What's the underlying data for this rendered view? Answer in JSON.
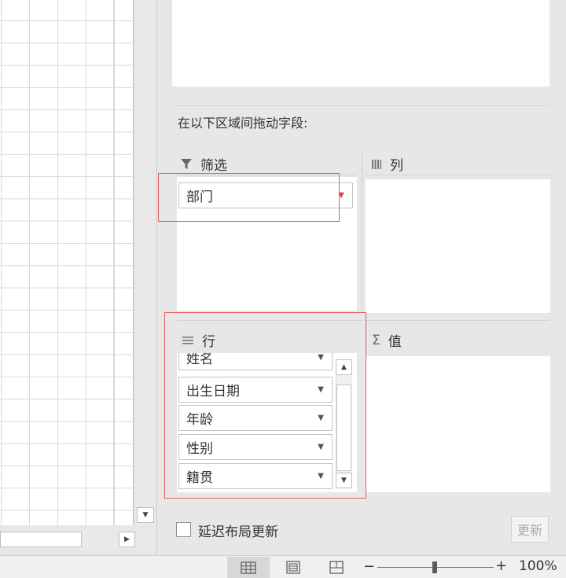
{
  "pane": {
    "drag_hint": "在以下区域间拖动字段:",
    "filters": {
      "title": "筛选",
      "icon": "filter-icon",
      "fields": [
        "部门"
      ]
    },
    "columns": {
      "title": "列",
      "icon": "columns-icon",
      "fields": []
    },
    "rows": {
      "title": "行",
      "icon": "rows-icon",
      "fields": [
        "姓名",
        "出生日期",
        "年龄",
        "性别",
        "籍贯"
      ]
    },
    "values": {
      "title": "值",
      "icon": "sigma-icon",
      "fields": []
    },
    "defer_label": "延迟布局更新",
    "defer_checked": false,
    "update_label": "更新"
  },
  "highlight_color": "#e05b5b",
  "status_bar": {
    "views": [
      "normal-view-icon",
      "page-layout-icon",
      "page-break-icon"
    ],
    "zoom_minus": "−",
    "zoom_plus": "+",
    "zoom_level": "100%"
  }
}
